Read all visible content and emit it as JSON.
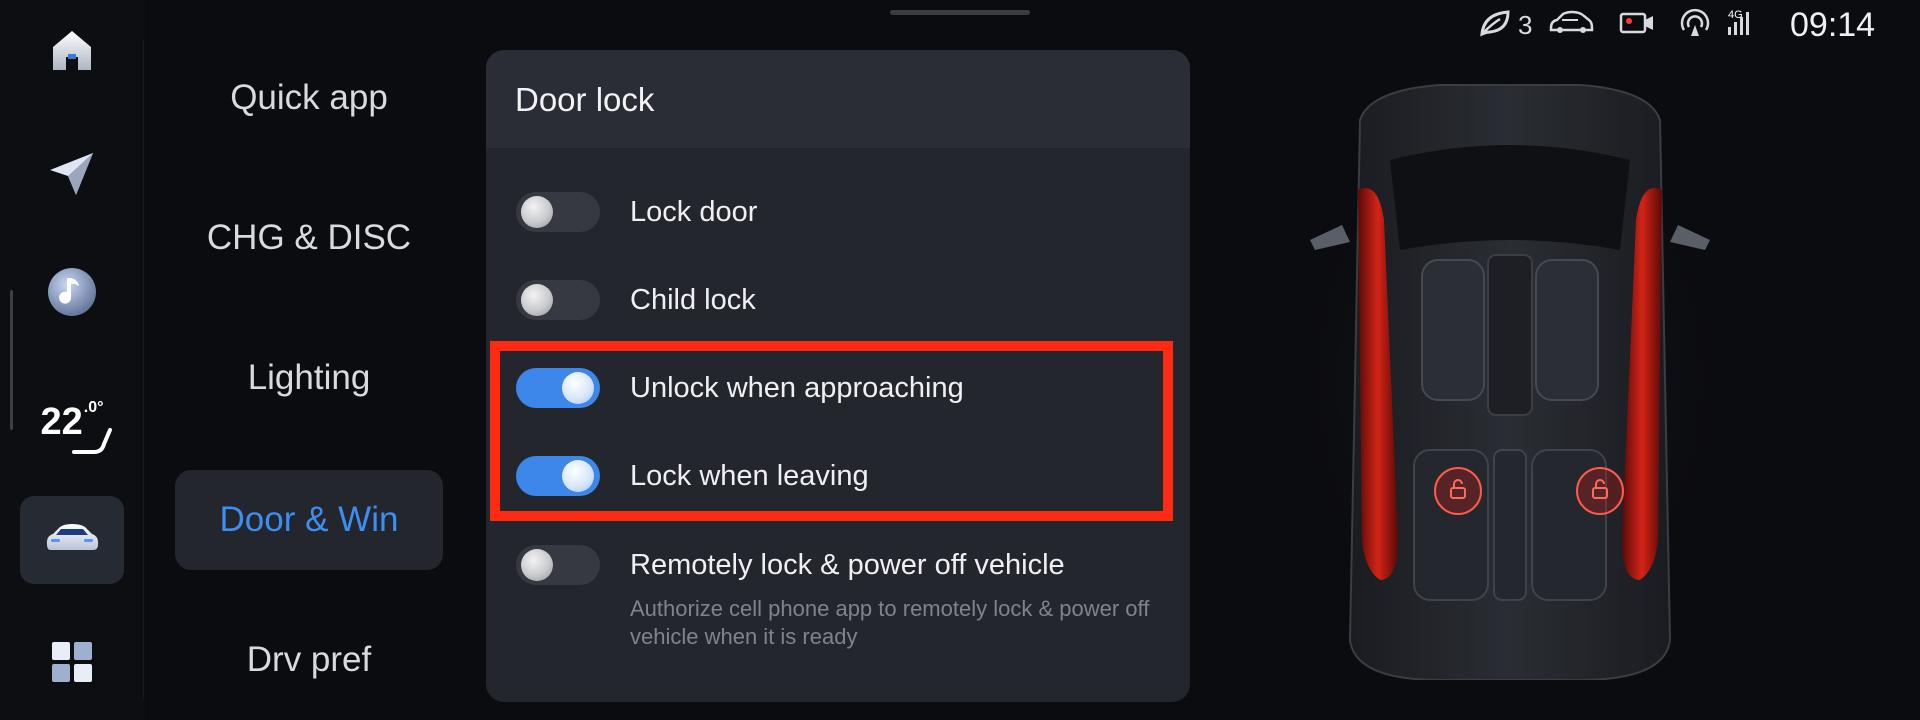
{
  "rail": {
    "items": [
      {
        "name": "home",
        "icon": "home-icon"
      },
      {
        "name": "navigation",
        "icon": "navigation-arrow-icon"
      },
      {
        "name": "music",
        "icon": "music-note-icon"
      },
      {
        "name": "climate",
        "icon": "seat-heat-icon",
        "temperature": "22",
        "temperature_decimal": ".0°"
      },
      {
        "name": "vehicle",
        "icon": "car-icon",
        "active": true
      },
      {
        "name": "apps",
        "icon": "apps-grid-icon"
      }
    ]
  },
  "menu": {
    "items": [
      {
        "label": "Quick app",
        "active": false
      },
      {
        "label": "CHG & DISC",
        "active": false
      },
      {
        "label": "Lighting",
        "active": false
      },
      {
        "label": "Door & Win",
        "active": true
      },
      {
        "label": "Drv pref",
        "active": false
      }
    ]
  },
  "panel": {
    "title": "Door lock",
    "rows": [
      {
        "label": "Lock door",
        "on": false
      },
      {
        "label": "Child lock",
        "on": false
      },
      {
        "label": "Unlock when approaching",
        "on": true
      },
      {
        "label": "Lock when leaving",
        "on": true
      },
      {
        "label": "Remotely lock & power off vehicle",
        "on": false,
        "description": "Authorize cell phone app to remotely lock & power off vehicle when it is ready"
      }
    ]
  },
  "status_bar": {
    "eco_count": "3",
    "network": "4G",
    "time": "09:14",
    "icons": [
      "eco-leaf-icon",
      "car-status-icon",
      "dashcam-icon",
      "hotspot-icon",
      "signal-icon"
    ]
  },
  "colors": {
    "accent": "#3d8ef2",
    "highlight": "#ff2a12",
    "panel": "#24262d",
    "background": "#0b0c0f"
  }
}
